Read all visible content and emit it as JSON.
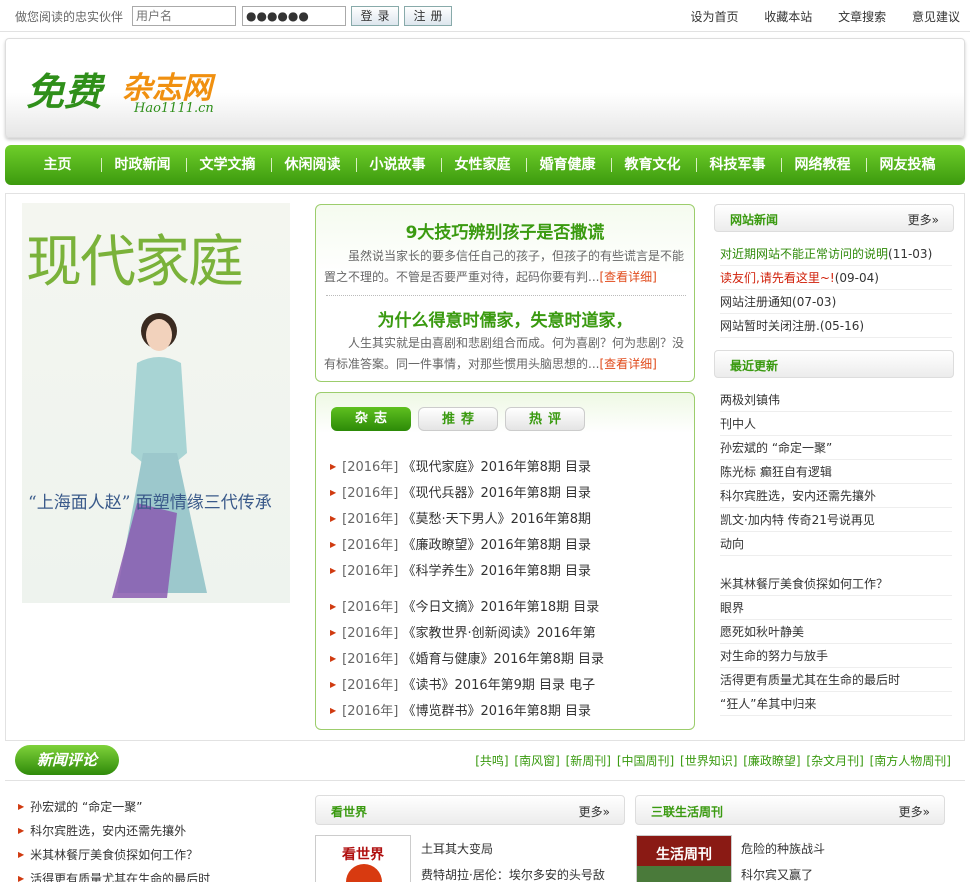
{
  "topbar": {
    "hint": "做您阅读的忠实伙伴",
    "username_placeholder": "用户名",
    "password_value": "●●●●●●",
    "login_label": "登录",
    "register_label": "注册",
    "links": [
      "设为首页",
      "收藏本站",
      "文章搜索",
      "意见建议"
    ]
  },
  "logo": {
    "main": "免费",
    "accent": "杂志网",
    "sub": "Hao1111.cn"
  },
  "nav": [
    "主页",
    "时政新闻",
    "文学文摘",
    "休闲阅读",
    "小说故事",
    "女性家庭",
    "婚育健康",
    "教育文化",
    "科技军事",
    "网络教程",
    "网友投稿"
  ],
  "cover": {
    "title": "现代家庭",
    "quote": "“上海面人赵” 面塑情缘三代传承"
  },
  "articles": [
    {
      "title": "9大技巧辨别孩子是否撒谎",
      "summary": "虽然说当家长的要多信任自己的孩子，但孩子的有些谎言是不能置之不理的。不管是否要严重对待，起码你要有判...",
      "more": "[查看详细]"
    },
    {
      "title": "为什么得意时儒家，失意时道家，",
      "summary": "人生其实就是由喜剧和悲剧组合而成。何为喜剧？何为悲剧？没有标准答案。同一件事情，对那些惯用头脑思想的...",
      "more": "[查看详细]"
    }
  ],
  "mag_tabs": [
    "杂志",
    "推荐",
    "热评"
  ],
  "mag_items": [
    {
      "year": "[2016年]",
      "name": "《现代家庭》2016年第8期 目录"
    },
    {
      "year": "[2016年]",
      "name": "《现代兵器》2016年第8期 目录"
    },
    {
      "year": "[2016年]",
      "name": "《莫愁·天下男人》2016年第8期"
    },
    {
      "year": "[2016年]",
      "name": "《廉政瞭望》2016年第8期 目录"
    },
    {
      "year": "[2016年]",
      "name": "《科学养生》2016年第8期 目录"
    },
    {
      "year": "[2016年]",
      "name": "《今日文摘》2016年第18期 目录"
    },
    {
      "year": "[2016年]",
      "name": "《家教世界·创新阅读》2016年第"
    },
    {
      "year": "[2016年]",
      "name": "《婚育与健康》2016年第8期 目录"
    },
    {
      "year": "[2016年]",
      "name": "《读书》2016年第9期 目录 电子"
    },
    {
      "year": "[2016年]",
      "name": "《博览群书》2016年第8期 目录"
    }
  ],
  "site_news": {
    "title": "网站新闻",
    "more": "更多»",
    "items": [
      {
        "text": "对近期网站不能正常访问的说明",
        "date": "(11-03)",
        "color": "#2f8a0a"
      },
      {
        "text": "读友们,请先看这里~!",
        "date": "(09-04)",
        "color": "#d0200a"
      },
      {
        "text": "网站注册通知",
        "date": "(07-03)",
        "color": "#333333"
      },
      {
        "text": "网站暂时关闭注册.",
        "date": "(05-16)",
        "color": "#333333"
      }
    ]
  },
  "latest": {
    "title": "最近更新",
    "items": [
      "两极刘镇伟",
      "刊中人",
      "孙宏斌的 “命定一聚”",
      "陈光标 癫狂自有逻辑",
      "科尔宾胜选，安内还需先攘外",
      "凯文·加内特 传奇21号说再见",
      "动向",
      "米其林餐厅美食侦探如何工作？",
      "眼界",
      "愿死如秋叶静美",
      "对生命的努力与放手",
      "活得更有质量尤其在生命的最后时",
      "“狂人”牟其中归来"
    ]
  },
  "news_review": {
    "label": "新闻评论",
    "tags": [
      "[共鸣]",
      "[南风窗]",
      "[新周刊]",
      "[中国周刊]",
      "[世界知识]",
      "[廉政瞭望]",
      "[杂文月刊]",
      "[南方人物周刊]"
    ],
    "items": [
      "孙宏斌的 “命定一聚”",
      "科尔宾胜选，安内还需先攘外",
      "米其林餐厅美食侦探如何工作？",
      "活得更有质量尤其在生命的最后时"
    ]
  },
  "box1": {
    "title": "看世界",
    "more": "更多»",
    "cover": "看世界",
    "items": [
      "土耳其大变局",
      "费特胡拉·居伦：埃尔多安的头号敌"
    ]
  },
  "box2": {
    "title": "三联生活周刊",
    "more": "更多»",
    "cover": "生活周刊",
    "items": [
      "危险的种族战斗",
      "科尔宾又赢了"
    ]
  }
}
